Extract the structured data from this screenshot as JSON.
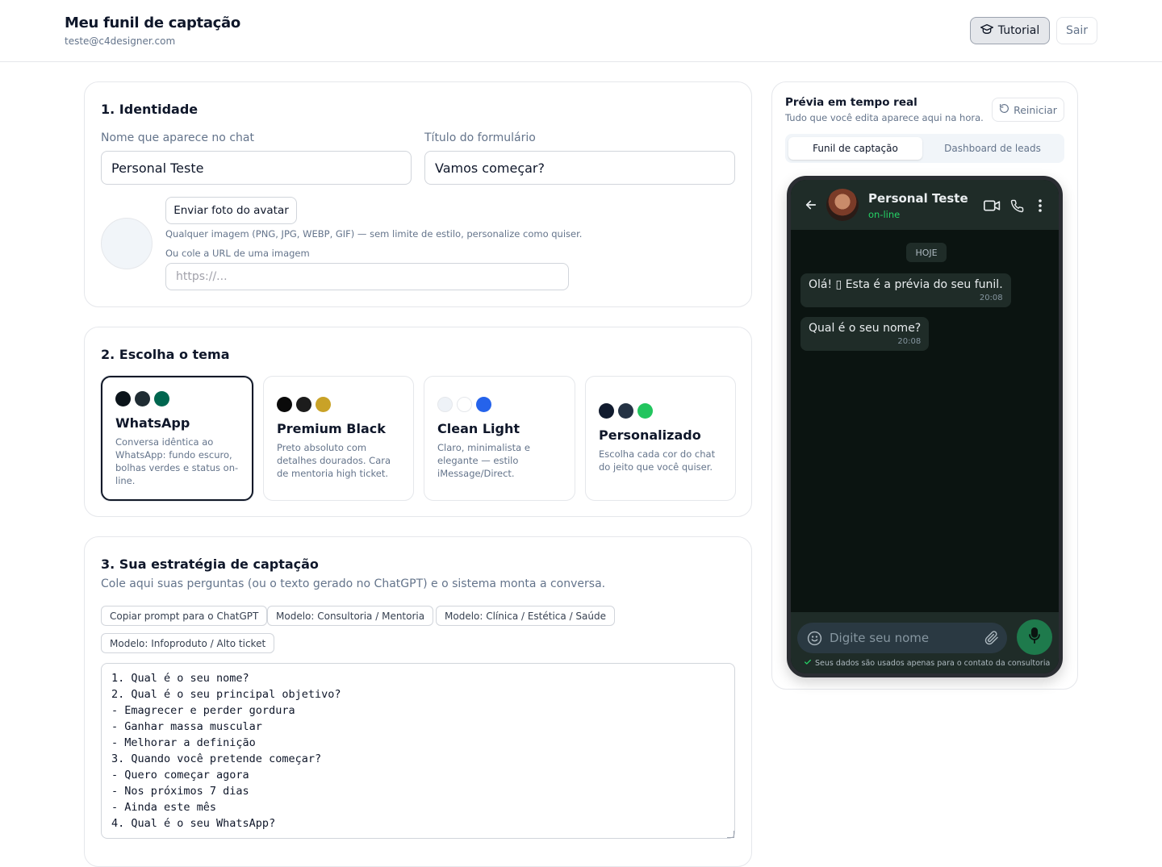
{
  "header": {
    "title": "Meu funil de captação",
    "email": "teste@c4designer.com",
    "tutorial_label": "Tutorial",
    "exit_label": "Sair"
  },
  "identity": {
    "title": "1. Identidade",
    "chat_name_label": "Nome que aparece no chat",
    "chat_name_value": "Personal Teste",
    "form_title_label": "Título do formulário",
    "form_title_value": "Vamos começar?",
    "upload_label": "Enviar foto do avatar",
    "upload_hint": "Qualquer imagem (PNG, JPG, WEBP, GIF) — sem limite de estilo, personalize como quiser.",
    "url_label": "Ou cole a URL de uma imagem",
    "url_placeholder": "https://..."
  },
  "themes": {
    "title": "2. Escolha o tema",
    "items": [
      {
        "name": "WhatsApp",
        "description": "Conversa idêntica ao WhatsApp: fundo escuro, bolhas verdes e status on-line.",
        "colors": [
          "#0b141a",
          "#1f2c33",
          "#00664f"
        ],
        "selected": true
      },
      {
        "name": "Premium Black",
        "description": "Preto absoluto com detalhes dourados. Cara de mentoria high ticket.",
        "colors": [
          "#0a0a0a",
          "#1c1c1c",
          "#c9a227"
        ],
        "selected": false
      },
      {
        "name": "Clean Light",
        "description": "Claro, minimalista e elegante — estilo iMessage/Direct.",
        "colors": [
          "#eef2f7",
          "#ffffff",
          "#2563eb"
        ],
        "selected": false
      },
      {
        "name": "Personalizado",
        "description": "Escolha cada cor do chat do jeito que você quiser.",
        "colors": [
          "#111b2e",
          "#243244",
          "#22c55e"
        ],
        "selected": false
      }
    ]
  },
  "strategy": {
    "title": "3. Sua estratégia de captação",
    "subtitle": "Cole aqui suas perguntas (ou o texto gerado no ChatGPT) e o sistema monta a conversa.",
    "chips": [
      "Copiar prompt para o ChatGPT",
      "Modelo: Consultoria / Mentoria",
      "Modelo: Clínica / Estética / Saúde",
      "Modelo: Infoproduto / Alto ticket"
    ],
    "questions_text": "1. Qual é o seu nome?\n2. Qual é o seu principal objetivo?\n- Emagrecer e perder gordura\n- Ganhar massa muscular\n- Melhorar a definição\n3. Quando você pretende começar?\n- Quero começar agora\n- Nos próximos 7 dias\n- Ainda este mês\n4. Qual é o seu WhatsApp?"
  },
  "preview": {
    "title": "Prévia em tempo real",
    "subtitle": "Tudo que você edita aparece aqui na hora.",
    "restart_label": "Reiniciar",
    "tabs": [
      "Funil de captação",
      "Dashboard de leads"
    ],
    "active_tab": "Funil de captação",
    "chat": {
      "contact_name": "Personal Teste",
      "status": "on-line",
      "date_label": "HOJE",
      "messages": [
        {
          "text": "Olá! ▯ Esta é a prévia do seu funil.",
          "time": "20:08"
        },
        {
          "text": "Qual é o seu nome?",
          "time": "20:08"
        }
      ],
      "input_placeholder": "Digite seu nome",
      "privacy_note": "Seus dados são usados apenas para o contato da consultoria",
      "accent_color": "#25d366"
    }
  }
}
